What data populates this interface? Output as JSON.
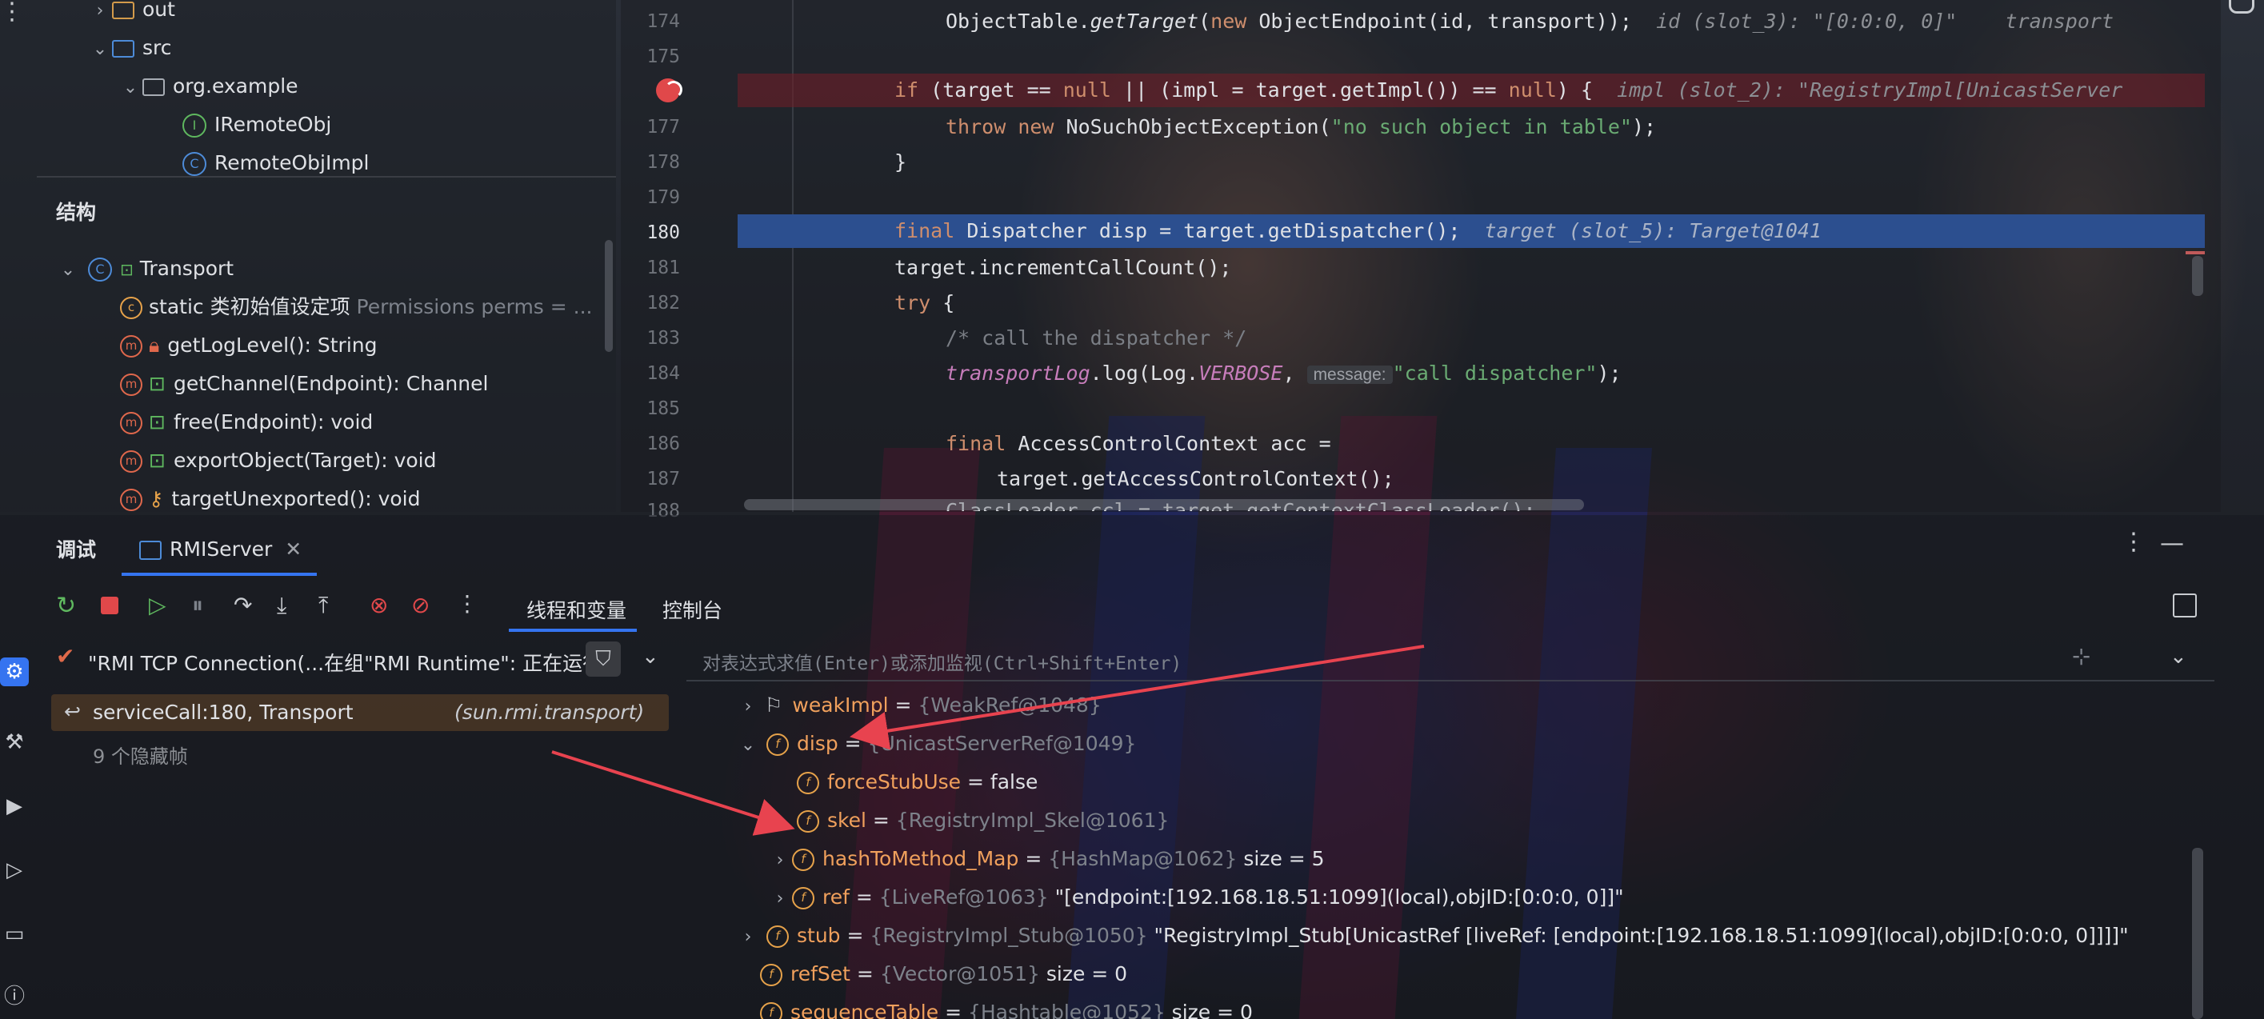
{
  "project_tree": {
    "items": [
      {
        "label": "out",
        "type": "folder"
      },
      {
        "label": "src",
        "type": "folder"
      },
      {
        "label": "org.example",
        "type": "package"
      },
      {
        "label": "IRemoteObj",
        "type": "interface"
      },
      {
        "label": "RemoteObjImpl",
        "type": "class"
      }
    ]
  },
  "structure": {
    "title": "结构",
    "root": "Transport",
    "items": [
      {
        "label": "static 类初始值设定项",
        "hint": "Permissions perms = ..."
      },
      {
        "label": "getLogLevel(): String"
      },
      {
        "label": "getChannel(Endpoint): Channel"
      },
      {
        "label": "free(Endpoint): void"
      },
      {
        "label": "exportObject(Target): void"
      },
      {
        "label": "targetUnexported(): void"
      }
    ]
  },
  "editor": {
    "line_numbers": [
      "174",
      "175",
      "",
      "177",
      "178",
      "179",
      "180",
      "181",
      "182",
      "183",
      "184",
      "185",
      "186",
      "187",
      "188"
    ],
    "lines": {
      "l174_a": "ObjectTable.",
      "l174_b": "getTarget",
      "l174_c": "(",
      "l174_d": "new",
      "l174_e": " ObjectEndpoint(id, transport));",
      "l174_hint": "id (slot_3): \"[0:0:0, 0]\"    transport",
      "l176_code": "(target == ",
      "l176_null1": "null",
      "l176_mid": " || (impl = target.getImpl()) == ",
      "l176_null2": "null",
      "l176_end": ") {",
      "l176_hint": "impl (slot_2): \"RegistryImpl[UnicastServer",
      "l177_throw": "throw",
      "l177_new": "new",
      "l177_mid": " NoSuchObjectException(",
      "l177_str": "\"no such object in table\"",
      "l177_end": ");",
      "l178": "}",
      "l180_final": "final",
      "l180_code": " Dispatcher disp = target.getDispatcher();",
      "l180_hint": "target (slot_5): Target@1041",
      "l181": "target.incrementCallCount();",
      "l182_try": "try",
      "l182_end": " {",
      "l183": "/* call the dispatcher */",
      "l184_log": "transportLog",
      "l184_mid": ".log(Log.",
      "l184_verbose": "VERBOSE",
      "l184_comma": ", ",
      "l184_param": "message:",
      "l184_str": "\"call dispatcher\"",
      "l184_end": ");",
      "l186_final": "final",
      "l186_code": " AccessControlContext acc =",
      "l187": "target.getAccessControlContext();",
      "l188": "ClassLoader ccl = target.getContextClassLoader();",
      "if_kw": "if"
    }
  },
  "debug": {
    "tool_title": "调试",
    "config_tab": "RMIServer",
    "tabs": [
      "线程和变量",
      "控制台"
    ],
    "thread": "\"RMI TCP Connection(...在组\"RMI Runtime\": 正在运行",
    "frame": "serviceCall:180, Transport",
    "frame_pkg": "(sun.rmi.transport)",
    "hidden_frames": "9 个隐藏帧",
    "eval_placeholder": "对表达式求值(Enter)或添加监视(Ctrl+Shift+Enter)",
    "variables": [
      {
        "name": "weakImpl",
        "eq": " = ",
        "ref": "{WeakRef@1048}",
        "value": ""
      },
      {
        "name": "disp",
        "eq": " = ",
        "ref": "{UnicastServerRef@1049}",
        "value": ""
      },
      {
        "name": "forceStubUse",
        "eq": " = ",
        "ref": "",
        "value": "false"
      },
      {
        "name": "skel",
        "eq": " = ",
        "ref": "{RegistryImpl_Skel@1061}",
        "value": ""
      },
      {
        "name": "hashToMethod_Map",
        "eq": " = ",
        "ref": "{HashMap@1062}",
        "value": " size = 5"
      },
      {
        "name": "ref",
        "eq": " = ",
        "ref": "{LiveRef@1063}",
        "value": " \"[endpoint:[192.168.18.51:1099](local),objID:[0:0:0, 0]]\""
      },
      {
        "name": "stub",
        "eq": " = ",
        "ref": "{RegistryImpl_Stub@1050}",
        "value": " \"RegistryImpl_Stub[UnicastRef [liveRef: [endpoint:[192.168.18.51:1099](local),objID:[0:0:0, 0]]]]\""
      },
      {
        "name": "refSet",
        "eq": " = ",
        "ref": "{Vector@1051}",
        "value": "  size = 0"
      },
      {
        "name": "sequenceTable",
        "eq": " = ",
        "ref": "{Hashtable@1052}",
        "value": "  size = 0"
      }
    ]
  },
  "colors": {
    "accent": "#3574f0",
    "execution_line": "#2c4f8f",
    "breakpoint": "#e0484a",
    "arrow": "#e8434f"
  }
}
